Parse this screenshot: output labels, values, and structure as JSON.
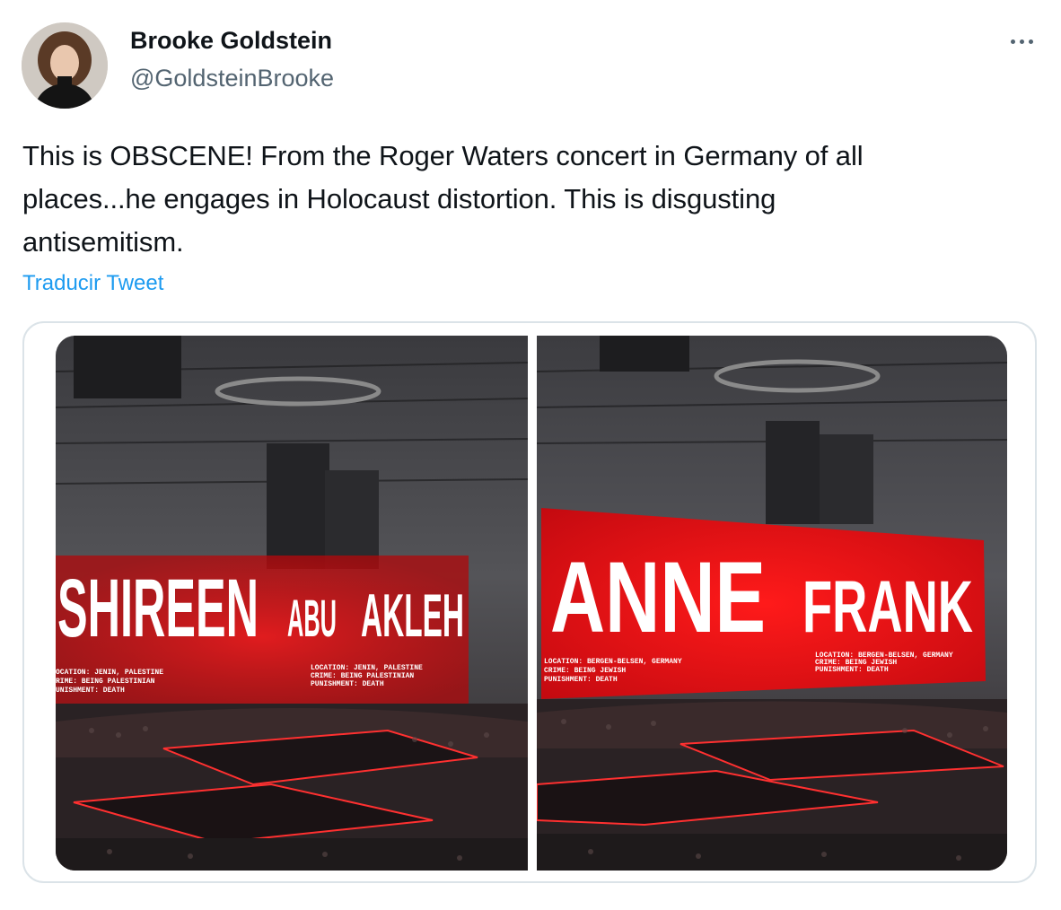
{
  "author": {
    "name": "Brooke Goldstein",
    "handle": "@GoldsteinBrooke"
  },
  "tweet": {
    "text_line1": "This is OBSCENE! From the Roger Waters concert in Germany of all",
    "text_line2": "places...he engages in Holocaust distortion. This is disgusting",
    "text_line3": "antisemitism.",
    "translate_label": "Traducir Tweet"
  },
  "media": {
    "left": {
      "headline_part1": "SHIREEN",
      "headline_part2": "ABU",
      "headline_part3": "AKLEH",
      "small_left_1": "OCATION:   JENIN, PALESTINE",
      "small_left_2": "RIME:      BEING PALESTINIAN",
      "small_left_3": "UNISHMENT: DEATH",
      "small_right_1": "LOCATION:   JENIN, PALESTINE",
      "small_right_2": "CRIME:      BEING PALESTINIAN",
      "small_right_3": "PUNISHMENT: DEATH"
    },
    "right": {
      "headline_part1": "ANNE",
      "headline_part2": "FRANK",
      "small_left_1": "LOCATION:   BERGEN-BELSEN, GERMANY",
      "small_left_2": "CRIME:      BEING JEWISH",
      "small_left_3": "PUNISHMENT: DEATH",
      "small_right_1": "LOCATION:   BERGEN-BELSEN, GERMANY",
      "small_right_2": "CRIME:      BEING JEWISH",
      "small_right_3": "PUNISHMENT: DEATH"
    }
  },
  "colors": {
    "text": "#0f1419",
    "secondary": "#536471",
    "link": "#1d9bf0",
    "screen_red": "#e3121b"
  }
}
